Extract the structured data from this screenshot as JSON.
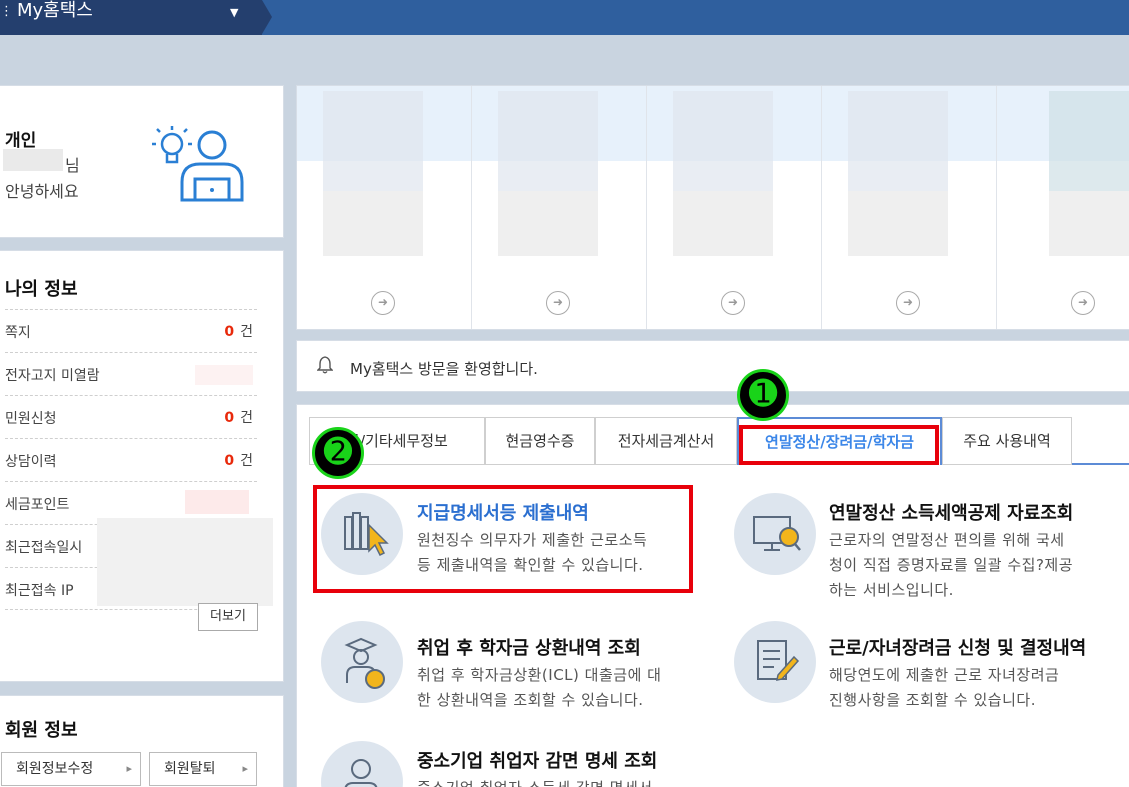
{
  "topbar": {
    "title": "My홈택스"
  },
  "greeting": {
    "user_type": "개인",
    "name_suffix": "님",
    "hello": "안녕하세요"
  },
  "my_info": {
    "title": "나의 정보",
    "rows": [
      {
        "label": "쪽지",
        "count": "0",
        "unit": "건"
      },
      {
        "label": "전자고지 미열람"
      },
      {
        "label": "민원신청",
        "count": "0",
        "unit": "건"
      },
      {
        "label": "상담이력",
        "count": "0",
        "unit": "건"
      },
      {
        "label": "세금포인트"
      },
      {
        "label": "최근접속일시"
      },
      {
        "label": "최근접속 IP"
      }
    ],
    "more_label": "더보기"
  },
  "member_info": {
    "title": "회원 정보",
    "edit_label": "회원정보수정",
    "withdraw_label": "회원탈퇴"
  },
  "notice": {
    "text": "My홈택스 방문을 환영합니다."
  },
  "tabs": [
    {
      "label": "물/기타세무정보"
    },
    {
      "label": "현금영수증"
    },
    {
      "label": "전자세금계산서"
    },
    {
      "label": "연말정산/장려금/학자금"
    },
    {
      "label": "주요 사용내역"
    }
  ],
  "annotations": {
    "badge1": "➊",
    "badge2": "➋"
  },
  "items": [
    {
      "title": "지급명세서등 제출내역",
      "desc": [
        "원천징수 의무자가 제출한 근로소득",
        "등 제출내역을 확인할 수 있습니다."
      ]
    },
    {
      "title": "연말정산 소득세액공제 자료조회",
      "desc": [
        "근로자의 연말정산 편의를 위해 국세",
        "청이 직접 증명자료를 일괄 수집?제공",
        "하는 서비스입니다."
      ]
    },
    {
      "title": "취업 후 학자금 상환내역 조회",
      "desc": [
        "취업 후 학자금상환(ICL) 대출금에 대",
        "한 상환내역을 조회할 수 있습니다."
      ]
    },
    {
      "title": "근로/자녀장려금 신청 및 결정내역",
      "desc": [
        "해당연도에 제출한 근로 자녀장려금",
        "진행사항을 조회할 수 있습니다."
      ]
    },
    {
      "title": "중소기업 취업자 감면 명세 조회",
      "desc": [
        "중소기업 취업자 소득세 감면 명세서"
      ]
    }
  ],
  "colors": {
    "accent": "#3b86e8",
    "highlight": "#e8000a",
    "badge": "#19d319",
    "count": "#e8290b",
    "topbar": "#2f5f9e"
  }
}
